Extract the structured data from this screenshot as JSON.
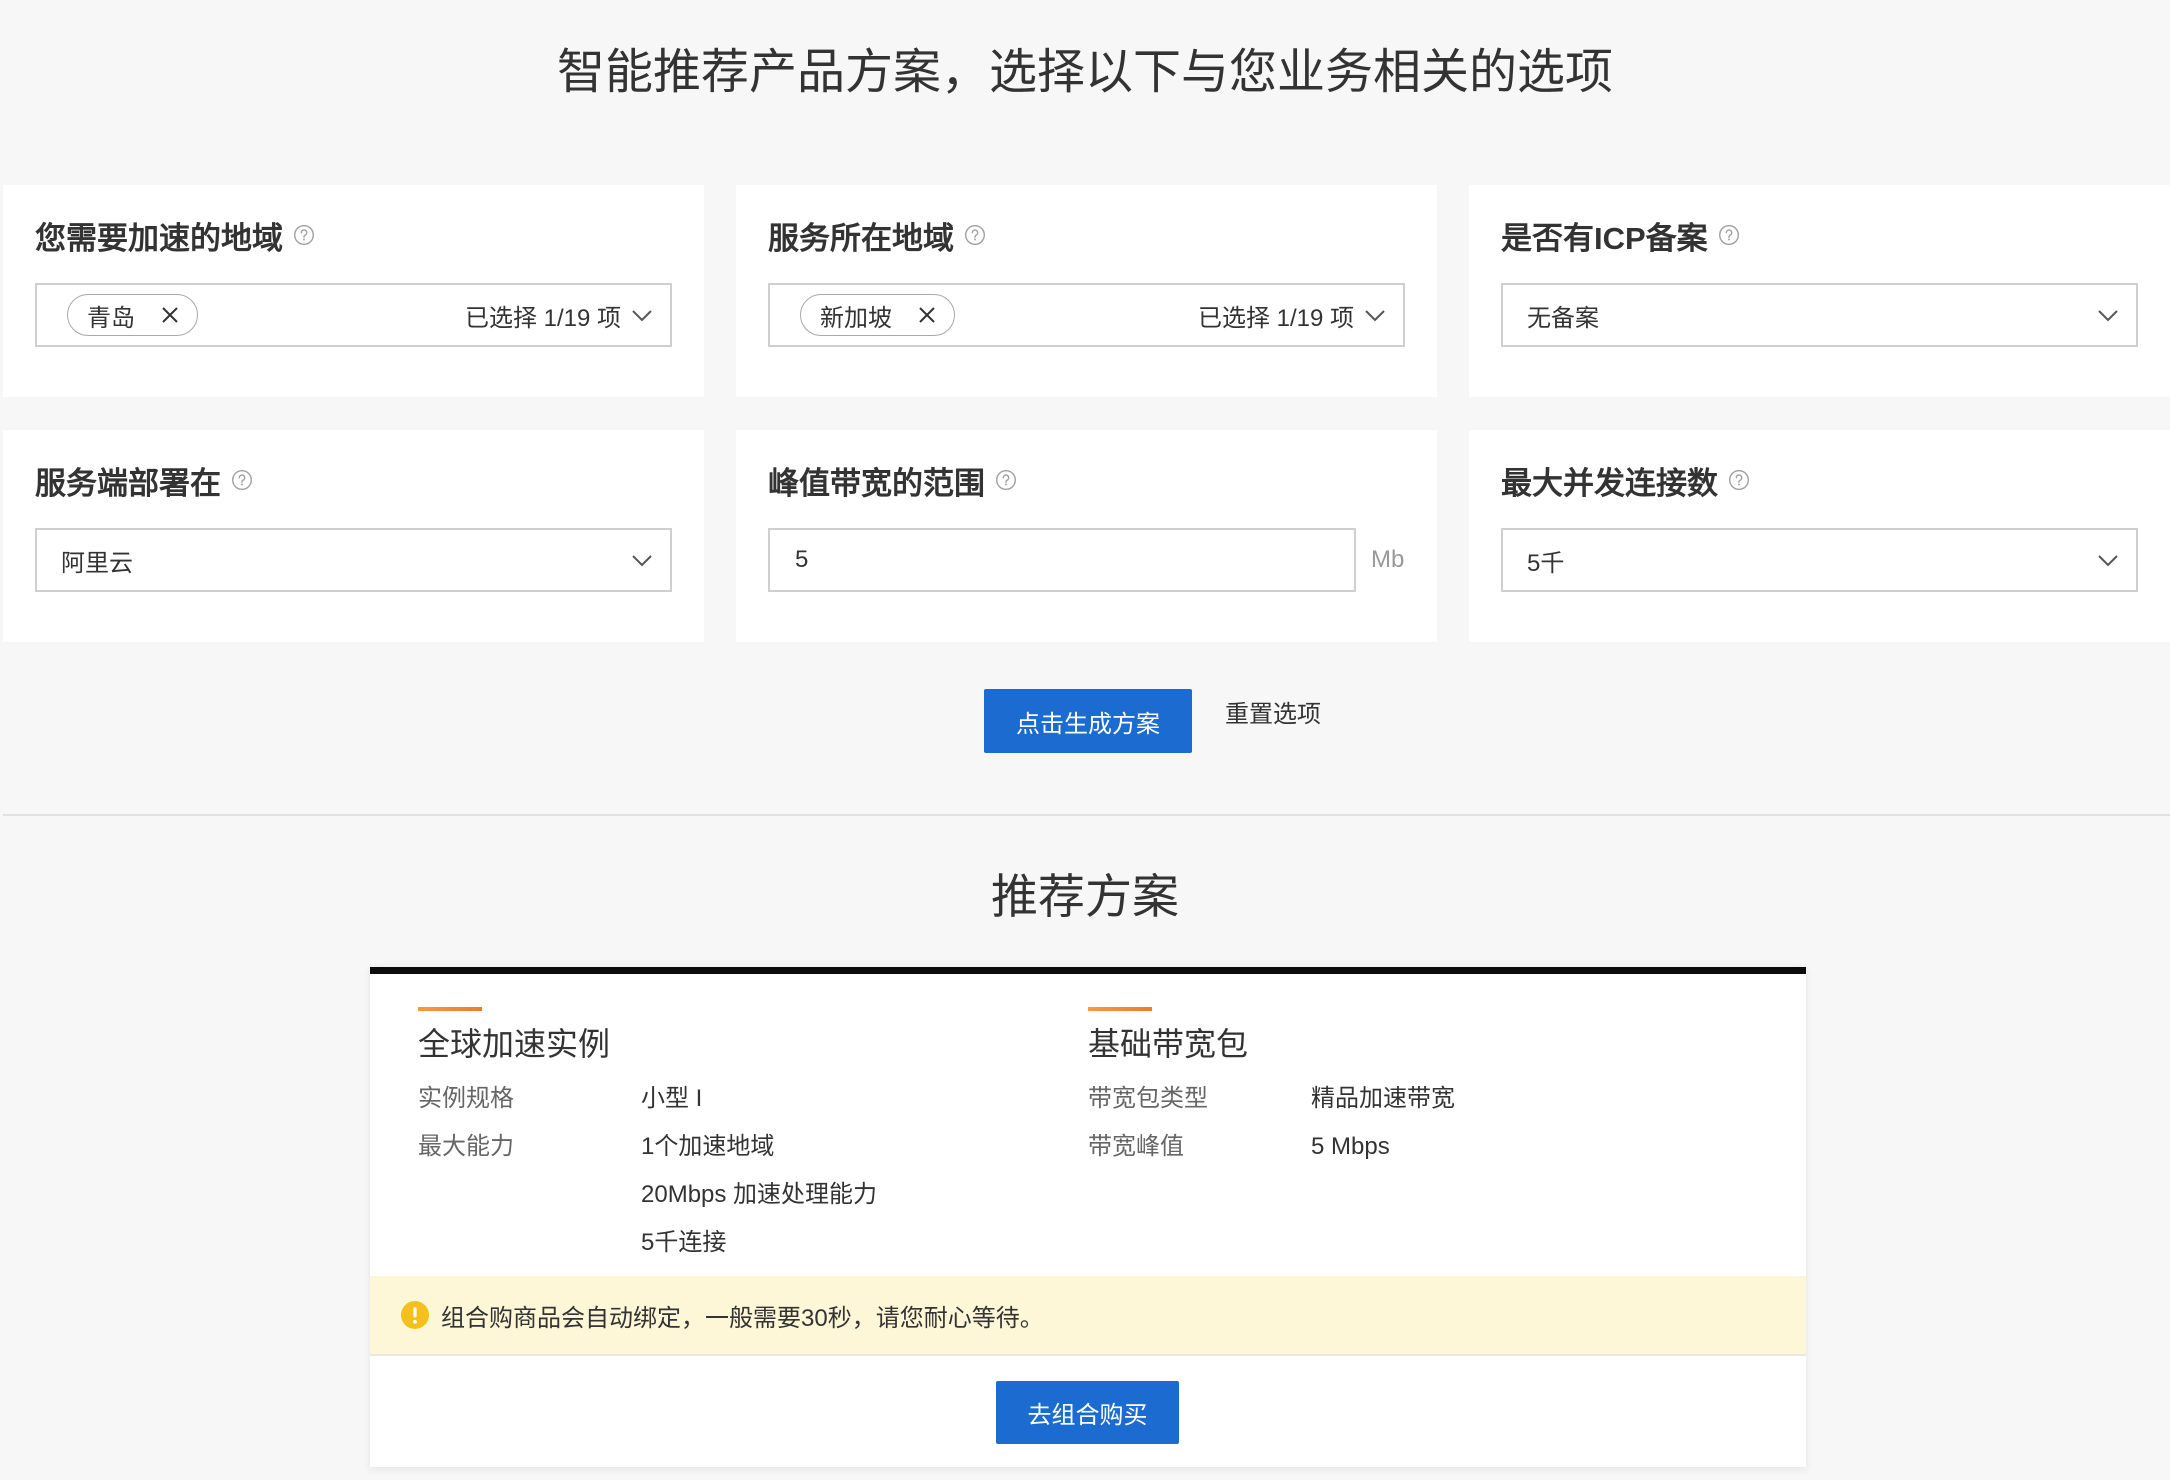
{
  "page": {
    "title": "智能推荐产品方案，选择以下与您业务相关的选项"
  },
  "form": {
    "accel_region": {
      "label": "您需要加速的地域",
      "tag": "青岛",
      "summary": "已选择 1/19 项"
    },
    "service_region": {
      "label": "服务所在地域",
      "tag": "新加坡",
      "summary": "已选择 1/19 项"
    },
    "icp": {
      "label": "是否有ICP备案",
      "value": "无备案"
    },
    "deployment": {
      "label": "服务端部署在",
      "value": "阿里云"
    },
    "peak_bandwidth": {
      "label": "峰值带宽的范围",
      "value": "5",
      "unit": "Mb"
    },
    "max_connections": {
      "label": "最大并发连接数",
      "value": "5千"
    },
    "generate_label": "点击生成方案",
    "reset_label": "重置选项"
  },
  "recommendation": {
    "heading": "推荐方案",
    "products": [
      {
        "title": "全球加速实例",
        "specs": [
          {
            "key": "实例规格",
            "values": [
              "小型 I"
            ]
          },
          {
            "key": "最大能力",
            "values": [
              "1个加速地域",
              "20Mbps 加速处理能力",
              "5千连接"
            ]
          }
        ]
      },
      {
        "title": "基础带宽包",
        "specs": [
          {
            "key": "带宽包类型",
            "values": [
              "精品加速带宽"
            ]
          },
          {
            "key": "带宽峰值",
            "values": [
              "5 Mbps"
            ]
          }
        ]
      }
    ],
    "notice": "组合购商品会自动绑定，一般需要30秒，请您耐心等待。",
    "buy_label": "去组合购买"
  },
  "icons": {
    "help": "help-circle-icon",
    "remove_tag": "close-icon",
    "expand": "chevron-down-icon",
    "notice": "warning-icon"
  },
  "colors": {
    "primary": "#1b6bd0",
    "accent": "#f0792f",
    "notice_bg": "#fdf6d7",
    "warning": "#f3c01c",
    "header_rule": "#0d0d0d"
  }
}
